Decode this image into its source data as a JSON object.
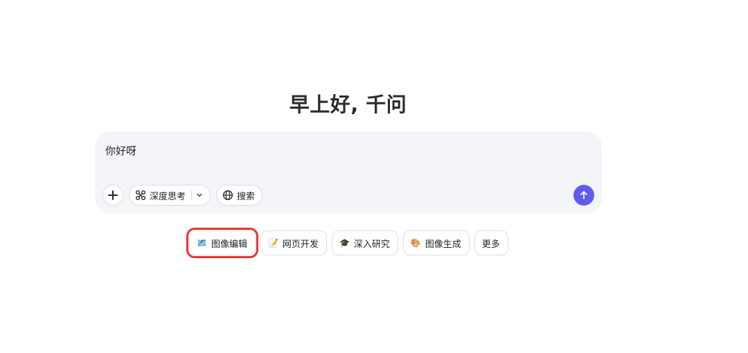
{
  "greeting": "早上好, 千问",
  "chat": {
    "input_text": "你好呀",
    "tools": {
      "deep_think_label": "深度思考",
      "search_label": "搜索"
    }
  },
  "suggestions": [
    {
      "icon": "🗺️",
      "label": "图像编辑"
    },
    {
      "icon": "📝",
      "label": "网页开发"
    },
    {
      "icon": "🎓",
      "label": "深入研究"
    },
    {
      "icon": "🎨",
      "label": "图像生成"
    },
    {
      "label": "更多"
    }
  ],
  "colors": {
    "send_button": "#615cf0",
    "chat_bg": "#f4f5f9",
    "highlight": "#e8312f"
  }
}
